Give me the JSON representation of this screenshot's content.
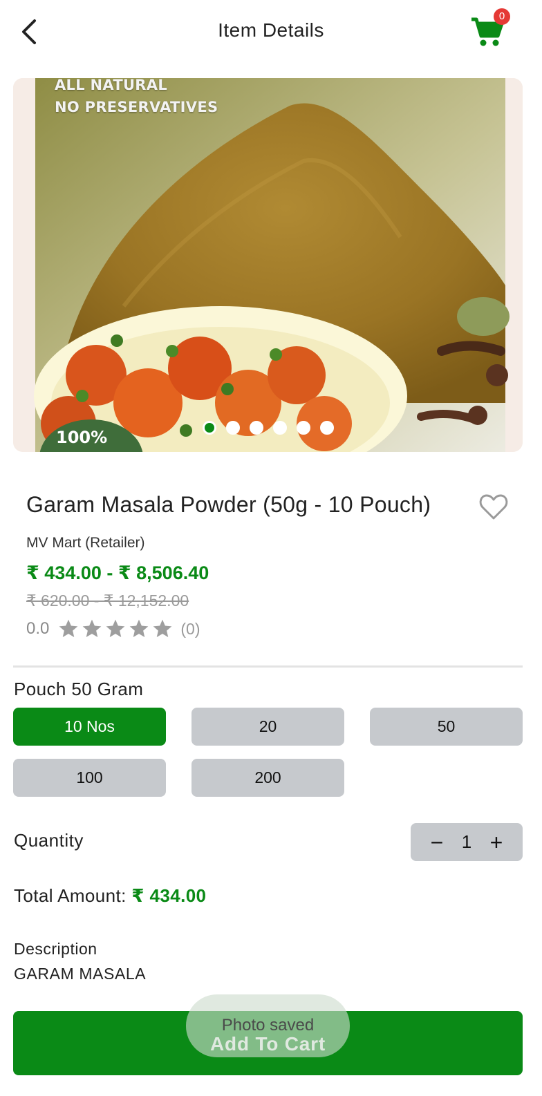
{
  "header": {
    "title": "Item Details",
    "back_icon": "chevron-left-icon",
    "cart_icon": "cart-icon",
    "cart_count": "0"
  },
  "gallery": {
    "banner_line1": "ALL NATURAL",
    "banner_line2": "NO PRESERVATIVES",
    "badge_text": "100%",
    "slides_total": 6,
    "active_slide": 1
  },
  "product": {
    "title": "Garam Masala Powder (50g - 10 Pouch)",
    "seller": "MV Mart (Retailer)",
    "price_range": "₹ 434.00 - ₹ 8,506.40",
    "mrp_range": "₹ 620.00 - ₹ 12,152.00",
    "rating_value": "0.0",
    "rating_stars": 0,
    "rating_max": 5,
    "rating_count": "(0)"
  },
  "variants": {
    "label": "Pouch 50 Gram",
    "options": [
      "10 Nos",
      "20",
      "50",
      "100",
      "200"
    ],
    "selected": "10 Nos"
  },
  "quantity": {
    "label": "Quantity",
    "value": "1",
    "minus": "−",
    "plus": "+"
  },
  "total": {
    "label": "Total Amount:",
    "value": "₹ 434.00"
  },
  "description": {
    "label": "Description",
    "text": "GARAM MASALA"
  },
  "actions": {
    "add_to_cart": "Add To Cart"
  },
  "toast": {
    "text": "Photo saved"
  },
  "colors": {
    "accent": "#0a8a16",
    "badge": "#e53935",
    "option_bg": "#c6c9cd",
    "muted_text": "#9a9a9a"
  }
}
